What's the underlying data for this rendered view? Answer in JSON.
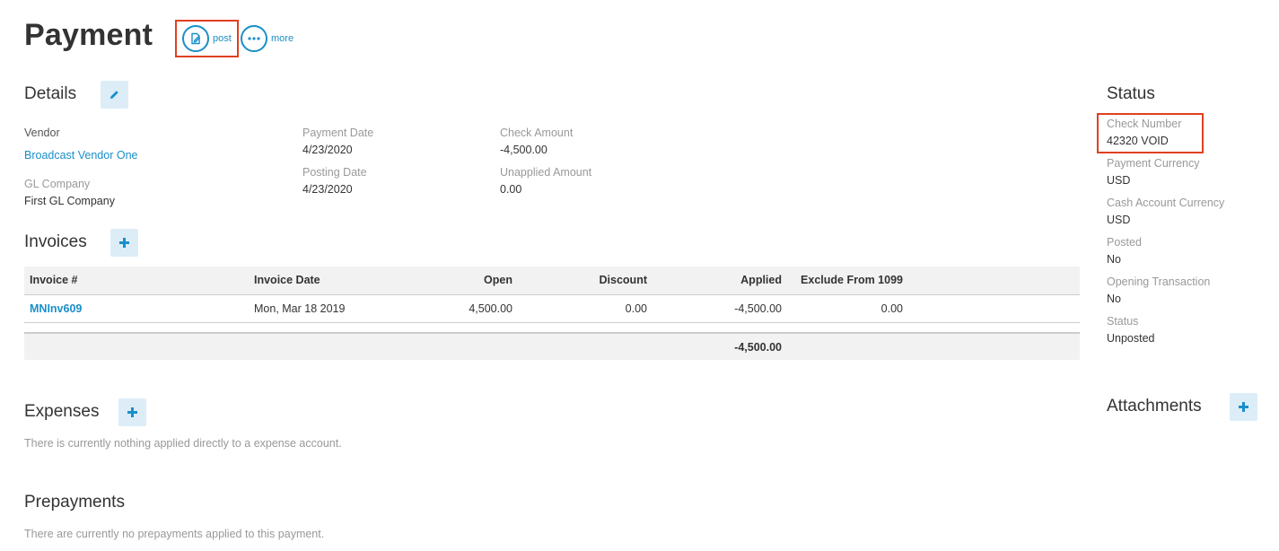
{
  "header": {
    "title": "Payment",
    "actions": [
      {
        "label": "post",
        "icon": "edit-document-icon"
      },
      {
        "label": "more",
        "icon": "ellipsis-icon"
      }
    ]
  },
  "details": {
    "title": "Details",
    "vendor_label": "Vendor",
    "vendor_value": "Broadcast Vendor One",
    "gl_company_label": "GL Company",
    "gl_company_value": "First GL Company",
    "payment_date_label": "Payment Date",
    "payment_date_value": "4/23/2020",
    "posting_date_label": "Posting Date",
    "posting_date_value": "4/23/2020",
    "check_amount_label": "Check Amount",
    "check_amount_value": "-4,500.00",
    "unapplied_amount_label": "Unapplied Amount",
    "unapplied_amount_value": "0.00"
  },
  "invoices": {
    "title": "Invoices",
    "columns": [
      "Invoice #",
      "Invoice Date",
      "Open",
      "Discount",
      "Applied",
      "Exclude From 1099"
    ],
    "rows": [
      {
        "invoice": "MNInv609",
        "date": "Mon, Mar 18 2019",
        "open": "4,500.00",
        "discount": "0.00",
        "applied": "-4,500.00",
        "exclude": "0.00"
      }
    ],
    "total_applied": "-4,500.00"
  },
  "expenses": {
    "title": "Expenses",
    "empty_text": "There is currently nothing applied directly to a expense account."
  },
  "prepayments": {
    "title": "Prepayments",
    "empty_text": "There are currently no prepayments applied to this payment."
  },
  "status": {
    "title": "Status",
    "fields": [
      {
        "label": "Check Number",
        "value": "42320 VOID"
      },
      {
        "label": "Payment Currency",
        "value": "USD"
      },
      {
        "label": "Cash Account Currency",
        "value": "USD"
      },
      {
        "label": "Posted",
        "value": "No"
      },
      {
        "label": "Opening Transaction",
        "value": "No"
      },
      {
        "label": "Status",
        "value": "Unposted"
      }
    ]
  },
  "attachments": {
    "title": "Attachments"
  },
  "colors": {
    "accent": "#1a8fc9",
    "highlight": "#e0401f",
    "button_bg": "#dcedf8"
  }
}
